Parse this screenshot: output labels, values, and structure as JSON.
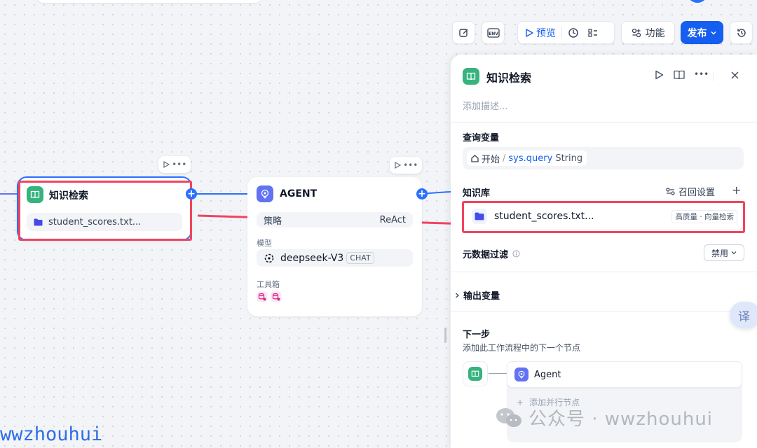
{
  "toolbar": {
    "preview_label": "预览",
    "features_label": "功能",
    "publish_label": "发布"
  },
  "canvas": {
    "knowledge_node": {
      "title": "知识检索",
      "file": "student_scores.txt..."
    },
    "agent_node": {
      "title": "AGENT",
      "strategy_label": "策略",
      "strategy_value": "ReAct",
      "model_label": "模型",
      "model_name": "deepseek-V3",
      "model_tag": "CHAT",
      "toolbox_label": "工具箱"
    }
  },
  "panel": {
    "title": "知识检索",
    "description_placeholder": "添加描述...",
    "query_variable": {
      "title": "查询变量",
      "source": "开始",
      "slash": "/",
      "variable": "sys.query",
      "type": "String"
    },
    "knowledge": {
      "title": "知识库",
      "recall_settings": "召回设置",
      "file": "student_scores.txt...",
      "badge": "高质量 · 向量检索"
    },
    "metadata_filter": {
      "title": "元数据过滤",
      "value": "禁用"
    },
    "output_variables": "输出变量",
    "next_step": {
      "title": "下一步",
      "description": "添加此工作流程中的下一个节点",
      "next_node": "Agent",
      "add_parallel": "添加并行节点"
    }
  },
  "translate_button": "译",
  "watermark": {
    "left": "wwzhouhui",
    "right": "公众号 · wwzhouhui"
  },
  "colors": {
    "accent": "#155eef",
    "annotation_red": "#f0445e",
    "knowledge_green": "#36b37e",
    "agent_purple": "#6172f3"
  }
}
